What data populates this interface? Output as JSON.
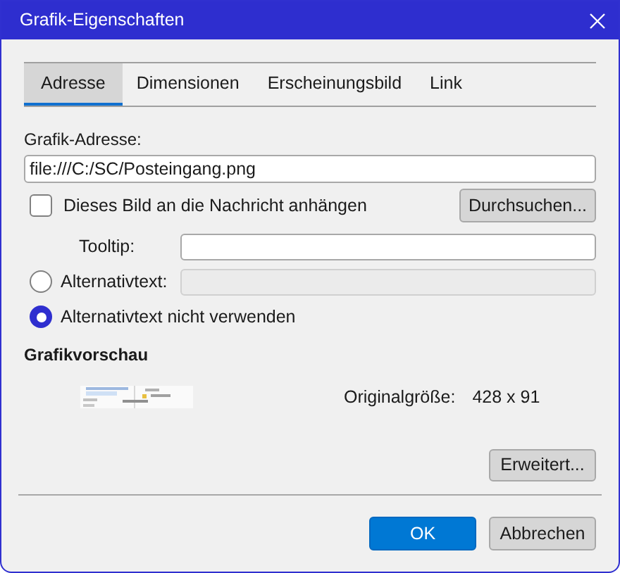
{
  "window": {
    "title": "Grafik-Eigenschaften"
  },
  "tabs": [
    {
      "label": "Adresse",
      "selected": true
    },
    {
      "label": "Dimensionen",
      "selected": false
    },
    {
      "label": "Erscheinungsbild",
      "selected": false
    },
    {
      "label": "Link",
      "selected": false
    }
  ],
  "address": {
    "label": "Grafik-Adresse:",
    "value": "file:///C:/SC/Posteingang.png"
  },
  "attach": {
    "label": "Dieses Bild an die Nachricht anhängen",
    "checked": false
  },
  "browse_button": "Durchsuchen...",
  "tooltip": {
    "label": "Tooltip:"
  },
  "alt_options": [
    {
      "label": "Alternativtext:",
      "selected": false,
      "has_field": true
    },
    {
      "label": "Alternativtext nicht verwenden",
      "selected": true,
      "has_field": false
    }
  ],
  "preview": {
    "heading": "Grafikvorschau",
    "kind": "picture",
    "size_label": "Originalgröße:",
    "size": "428 x 91"
  },
  "advanced_button": "Erweitert...",
  "buttons": [
    {
      "label": "OK",
      "kind": "primary"
    },
    {
      "label": "Abbrechen",
      "kind": "normal"
    }
  ]
}
